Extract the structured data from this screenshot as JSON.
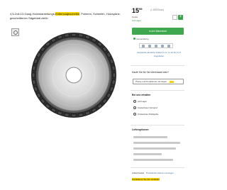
{
  "product": {
    "title_parts": [
      "4,5-Zoll-13-Gang-Holzbearbeitungs-",
      "Kettenzagescheibe",
      ", Polieren, Schleifen, Holzspäne, geschnittenen Sägeblatt ziehb"
    ]
  },
  "buy_box": {
    "price": "15",
    "price_cents": "99",
    "price_unit": "(1,50€/Stück)",
    "delivery": "Gratis",
    "stock": "Auf Lager",
    "add_to_cart": "In den Warenkorb",
    "shipping_hint": "Versandfertig",
    "more_offers": "Vergleiche ähnliche Artikel & Co. & mit bis zu 5 Angeboten",
    "share_label": "Teilen"
  },
  "compare_section": {
    "title": "Kaufe Sie für Sie interessant sein?",
    "button": "Preise und Konditionen anzeigen"
  },
  "pickup_section": {
    "title": "Bei uns erhalten",
    "items": [
      "Auf Lager",
      "Kostenloser Versand",
      "Kostenlose Rückgabe"
    ]
  },
  "details_section": {
    "title": "Lieferoptionen"
  },
  "footer": {
    "line1": "Artikel Details",
    "line1_link": "Produktinformationen anzeigen",
    "line2": "Kontaktieren Sie den Verkäufer"
  },
  "colors": {
    "accent_green": "#3ea84e",
    "highlight_yellow": "#f5d300",
    "link_blue": "#3b6ea5"
  }
}
